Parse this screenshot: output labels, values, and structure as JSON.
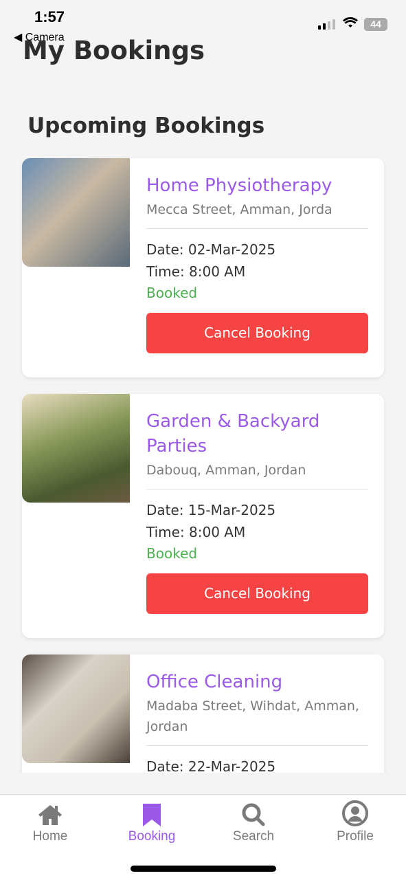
{
  "status": {
    "time": "1:57",
    "back_label": "Camera",
    "battery": "44"
  },
  "header": {
    "title": "My Bookings"
  },
  "section_title": "Upcoming Bookings",
  "colors": {
    "accent": "#9b59e8",
    "cancel": "#f64444",
    "booked": "#4caf50"
  },
  "bookings": [
    {
      "title": "Home Physiotherapy",
      "address": "Mecca Street, Amman, Jorda",
      "date": "Date: 02-Mar-2025",
      "time": "Time: 8:00 AM",
      "status": "Booked",
      "button": "Cancel Booking"
    },
    {
      "title": "Garden & Backyard Parties",
      "address": "Dabouq, Amman, Jordan",
      "date": "Date: 15-Mar-2025",
      "time": "Time: 8:00 AM",
      "status": "Booked",
      "button": "Cancel Booking"
    },
    {
      "title": "Office Cleaning",
      "address": "Madaba Street, Wihdat, Amman, Jordan",
      "date": "Date: 22-Mar-2025"
    }
  ],
  "nav": [
    {
      "label": "Home",
      "icon": "home-icon"
    },
    {
      "label": "Booking",
      "icon": "bookmark-icon",
      "active": true
    },
    {
      "label": "Search",
      "icon": "search-icon"
    },
    {
      "label": "Profile",
      "icon": "profile-icon"
    }
  ]
}
